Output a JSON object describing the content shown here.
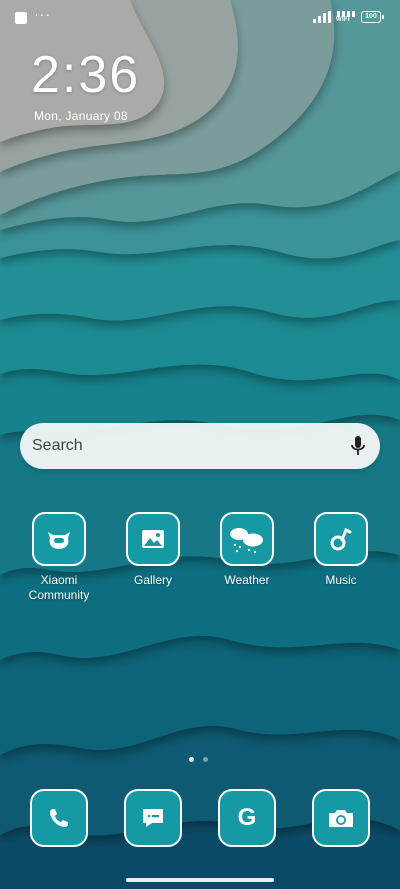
{
  "status_bar": {
    "notification_dots": "···",
    "wifi_label": "WIFI",
    "battery": "100"
  },
  "lockscreen_clock": {
    "time": "2:36",
    "date": "Mon, January 08"
  },
  "search": {
    "placeholder": "Search"
  },
  "apps": [
    {
      "label_line1": "Xiaomi",
      "label_line2": "Community",
      "icon": "xiaomi-community-icon"
    },
    {
      "label_line1": "Gallery",
      "icon": "gallery-icon"
    },
    {
      "label_line1": "Weather",
      "icon": "weather-icon"
    },
    {
      "label_line1": "Music",
      "icon": "music-icon"
    }
  ],
  "dock": [
    {
      "icon": "phone-icon"
    },
    {
      "icon": "messages-icon"
    },
    {
      "icon": "google-icon",
      "glyph": "G"
    },
    {
      "icon": "camera-icon"
    }
  ],
  "page_indicator": {
    "pages": 2,
    "current": 1
  },
  "colors": {
    "icon_tile": "#159aa5",
    "wallpaper_top": "#a9aba8",
    "wallpaper_bottom": "#0b4a66"
  }
}
